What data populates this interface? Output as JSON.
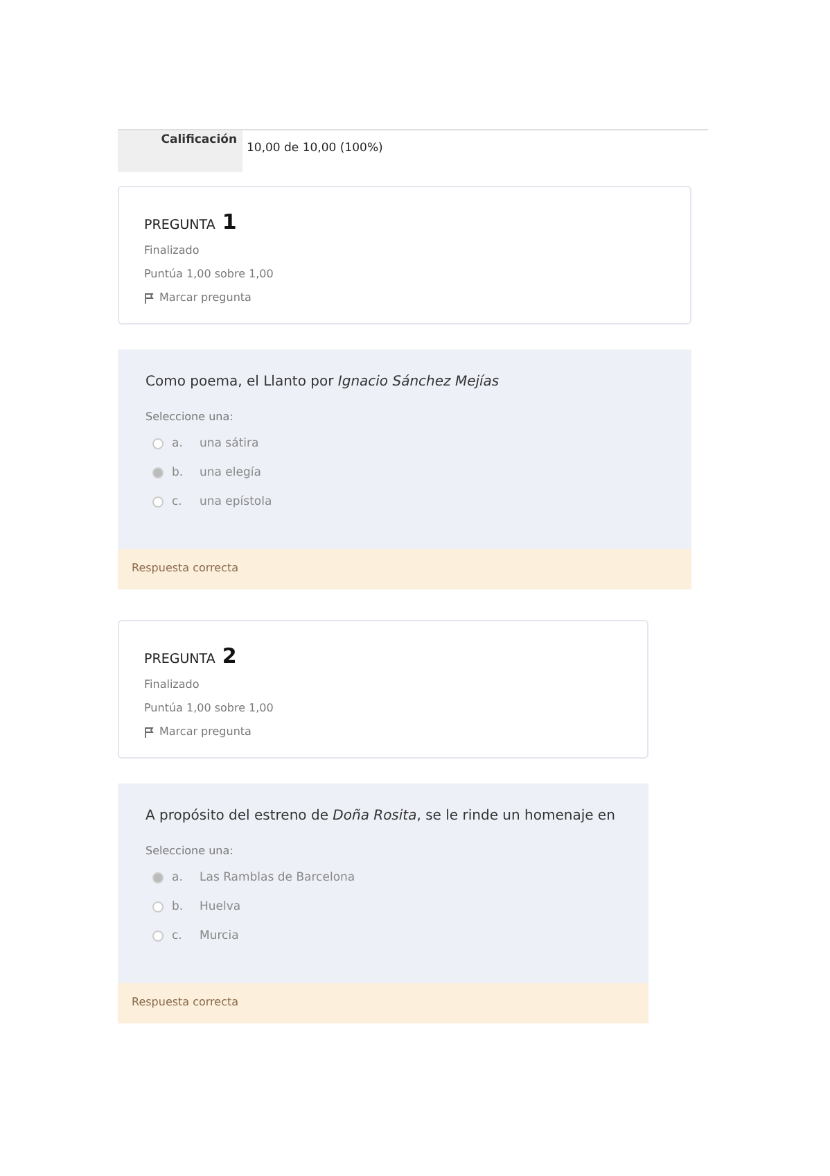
{
  "grade": {
    "label": "Calificación",
    "value": "10,00 de 10,00 (100%)"
  },
  "questions": [
    {
      "heading": "PREGUNTA",
      "number": "1",
      "status": "Finalizado",
      "score": "Puntúa 1,00 sobre 1,00",
      "flag": "Marcar pregunta",
      "text": "Como poema, el Llanto por *Ignacio Sánchez Mejías*",
      "prompt": "Seleccione una:",
      "options": [
        {
          "letter": "a.",
          "label": "una sátira",
          "selected": false
        },
        {
          "letter": "b.",
          "label": "una elegía",
          "selected": true
        },
        {
          "letter": "c.",
          "label": "una epístola",
          "selected": false
        }
      ],
      "feedback": "Respuesta correcta"
    },
    {
      "heading": "PREGUNTA",
      "number": "2",
      "status": "Finalizado",
      "score": "Puntúa 1,00 sobre 1,00",
      "flag": "Marcar pregunta",
      "text": "A propósito del estreno de *Doña Rosita*, se le rinde un homenaje en",
      "prompt": "Seleccione una:",
      "options": [
        {
          "letter": "a.",
          "label": "Las Ramblas de Barcelona",
          "selected": true
        },
        {
          "letter": "b.",
          "label": "Huelva",
          "selected": false
        },
        {
          "letter": "c.",
          "label": "Murcia",
          "selected": false
        }
      ],
      "feedback": "Respuesta correcta"
    }
  ]
}
